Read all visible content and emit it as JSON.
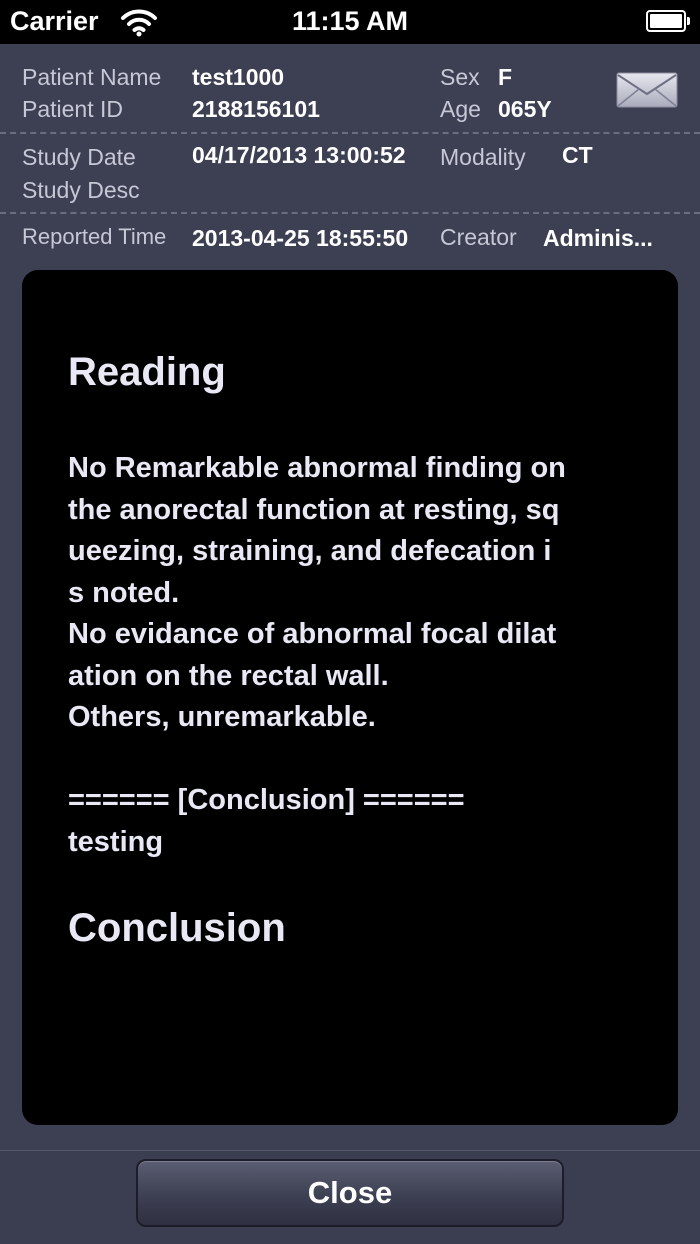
{
  "status_bar": {
    "carrier": "Carrier",
    "time": "11:15 AM"
  },
  "header": {
    "patient_name_label": "Patient Name",
    "patient_name": "test1000",
    "sex_label": "Sex",
    "sex": "F",
    "patient_id_label": "Patient ID",
    "patient_id": "2188156101",
    "age_label": "Age",
    "age": "065Y",
    "study_date_label": "Study Date",
    "study_date": "04/17/2013 13:00:52",
    "modality_label": "Modality",
    "modality": "CT",
    "study_desc_label": "Study Desc",
    "reported_time_label": "Reported Time",
    "reported_time": "2013-04-25 18:55:50",
    "creator_label": "Creator",
    "creator": "Adminis..."
  },
  "report": {
    "reading_title": "Reading",
    "reading_text": "No Remarkable abnormal finding on\nthe anorectal function at resting, sq\nueezing, straining, and defecation i\ns noted.\nNo evidance of abnormal focal dilat\nation on the rectal wall.\nOthers, unremarkable.\n\n====== [Conclusion] ======\ntesting",
    "conclusion_title": "Conclusion"
  },
  "toolbar": {
    "close_label": "Close"
  },
  "icons": {
    "mail": "envelope-icon",
    "wifi": "wifi-icon",
    "battery": "battery-icon"
  },
  "colors": {
    "panel": "#3d3f53",
    "report_bg": "#000000",
    "label": "#c7c8d6"
  }
}
